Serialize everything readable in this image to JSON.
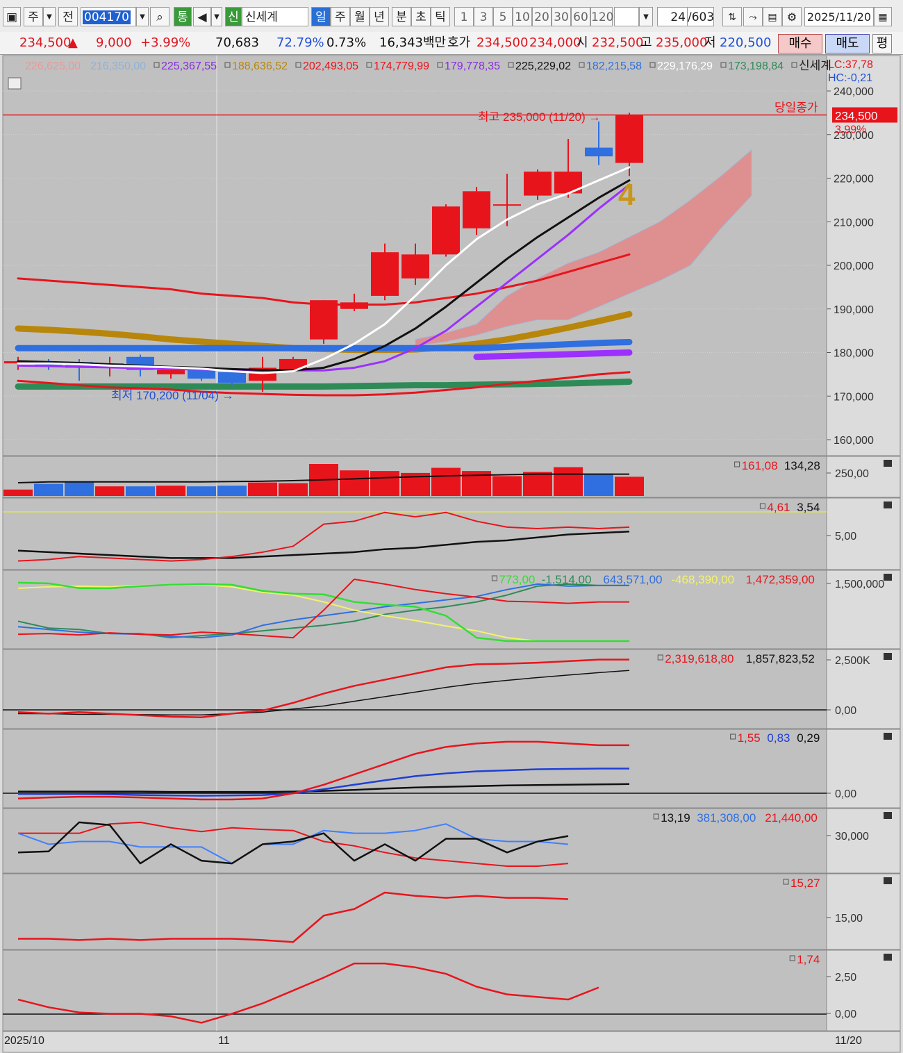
{
  "toolbar": {
    "freq": "주",
    "prev": "전",
    "code": "004170",
    "badge_tong": "통",
    "badge_sin": "신",
    "name": "신세계",
    "periods": [
      "일",
      "주",
      "월",
      "년",
      "분",
      "초",
      "틱"
    ],
    "active_period": "일",
    "intervals": [
      "1",
      "3",
      "5",
      "10",
      "20",
      "30",
      "60",
      "120"
    ],
    "count": "24",
    "total": "/603",
    "date": "2025/11/20"
  },
  "quote": {
    "price": "234,500",
    "arrow": "▲",
    "change": "9,000",
    "change_pct": "+3.99%",
    "volume": "70,683",
    "vol_ratio": "72.79%",
    "turnover": "0.73%",
    "amount": "16,343백만",
    "hoga_label": "호가",
    "ask": "234,500",
    "bid": "234,000",
    "open_label": "시",
    "open": "232,500",
    "high_label": "고",
    "high": "235,000",
    "low_label": "저",
    "low": "220,500",
    "buy": "매수",
    "sell": "매도",
    "eval": "평"
  },
  "colors": {
    "up": "#e8141c",
    "down": "#2f6fe0",
    "bg": "#c0c0c0",
    "axis_bg": "#dcdcdc"
  },
  "chart_data": {
    "type": "candlestick",
    "x_start_label": "2025/10",
    "x_mid_label": "11",
    "x_end_label": "11/20",
    "ylim": [
      155000,
      245000
    ],
    "price_ticks": [
      160000,
      170000,
      180000,
      190000,
      200000,
      210000,
      220000,
      230000,
      240000
    ],
    "price_tick_labels": [
      "160,000",
      "170,000",
      "180,000",
      "190,000",
      "200,000",
      "210,000",
      "220,000",
      "230,000",
      "240,000"
    ],
    "candles": [
      {
        "o": 177500,
        "h": 179000,
        "l": 176000,
        "c": 178000
      },
      {
        "o": 177500,
        "h": 178500,
        "l": 176000,
        "c": 177000
      },
      {
        "o": 177800,
        "h": 178500,
        "l": 173500,
        "c": 176500
      },
      {
        "o": 177000,
        "h": 179000,
        "l": 174500,
        "c": 177500
      },
      {
        "o": 179000,
        "h": 179500,
        "l": 174500,
        "c": 176000
      },
      {
        "o": 175000,
        "h": 176500,
        "l": 174000,
        "c": 176000
      },
      {
        "o": 176000,
        "h": 176500,
        "l": 173500,
        "c": 174000
      },
      {
        "o": 175500,
        "h": 176000,
        "l": 172500,
        "c": 173000
      },
      {
        "o": 173500,
        "h": 179000,
        "l": 171000,
        "c": 176500
      },
      {
        "o": 176000,
        "h": 179000,
        "l": 175500,
        "c": 178500
      },
      {
        "o": 183000,
        "h": 192000,
        "l": 182000,
        "c": 192000
      },
      {
        "o": 190000,
        "h": 193500,
        "l": 189500,
        "c": 191500
      },
      {
        "o": 193000,
        "h": 205000,
        "l": 192000,
        "c": 203000
      },
      {
        "o": 197000,
        "h": 205000,
        "l": 195500,
        "c": 202500
      },
      {
        "o": 202500,
        "h": 214000,
        "l": 202000,
        "c": 213500
      },
      {
        "o": 208500,
        "h": 218000,
        "l": 207000,
        "c": 217000
      },
      {
        "o": 214000,
        "h": 221000,
        "l": 209000,
        "c": 214000
      },
      {
        "o": 216000,
        "h": 222000,
        "l": 215000,
        "c": 221500
      },
      {
        "o": 216500,
        "h": 229000,
        "l": 215500,
        "c": 221500
      },
      {
        "o": 227000,
        "h": 233000,
        "l": 223000,
        "c": 225000
      },
      {
        "o": 223500,
        "h": 235000,
        "l": 220500,
        "c": 234500
      }
    ],
    "ma_legend": [
      {
        "value": "226,625,00",
        "color": "#e79a9a"
      },
      {
        "value": "216,350,00",
        "color": "#8fb1d8"
      },
      {
        "value": "225,367,55",
        "color": "#8a2be2"
      },
      {
        "value": "188,636,52",
        "color": "#b8860b"
      },
      {
        "value": "202,493,05",
        "color": "#e8141c"
      },
      {
        "value": "174,779,99",
        "color": "#e8141c"
      },
      {
        "value": "179,778,35",
        "color": "#8a2be2"
      },
      {
        "value": "225,229,02",
        "color": "#111111"
      },
      {
        "value": "182,215,58",
        "color": "#2f6fe0"
      },
      {
        "value": "229,176,29",
        "color": "#ffffff"
      },
      {
        "value": "173,198,84",
        "color": "#2e8b57"
      }
    ],
    "legend_name": "신세계",
    "lc": "LC:37,78",
    "hc": "HC:-0,21",
    "last_price_label": "234,500",
    "last_pct_label": "3,99%",
    "close_line_label": "당일종가",
    "high_annotation": "최고 235,000 (11/20)",
    "low_annotation": "최저 170,200 (11/04)",
    "count_marker": "4",
    "sma5": [
      177500,
      177500,
      177300,
      177000,
      176800,
      176600,
      176300,
      175700,
      175300,
      175700,
      178500,
      182000,
      186500,
      193000,
      200000,
      206000,
      210500,
      214000,
      216500,
      219500,
      222500
    ],
    "sma10": [
      178000,
      177800,
      177600,
      177300,
      177000,
      176700,
      176500,
      176200,
      176000,
      175900,
      176500,
      178500,
      181500,
      185500,
      190500,
      196000,
      201500,
      206500,
      211000,
      215500,
      219500
    ],
    "sma20": [
      177000,
      176900,
      176700,
      176600,
      176400,
      176200,
      176100,
      176000,
      176000,
      175900,
      175900,
      176500,
      178000,
      181000,
      185000,
      190500,
      196000,
      201500,
      207000,
      213000,
      218500
    ],
    "bb_upper": [
      197000,
      196500,
      196000,
      195500,
      195000,
      194500,
      193500,
      193000,
      192500,
      191500,
      191000,
      191000,
      191000,
      191500,
      192500,
      193500,
      195000,
      196500,
      198500,
      200500,
      202500
    ],
    "bb_lower": [
      173500,
      173000,
      172500,
      172000,
      171800,
      171500,
      171000,
      170700,
      170500,
      170300,
      170200,
      170200,
      170400,
      170800,
      171400,
      172000,
      172800,
      173500,
      174200,
      175000,
      175500
    ],
    "ma60": [
      185500,
      185200,
      184800,
      184300,
      183700,
      183000,
      182500,
      182000,
      181500,
      181000,
      180800,
      180600,
      180600,
      180700,
      181200,
      182000,
      183000,
      184300,
      185700,
      187200,
      188800
    ],
    "ma120": [
      181000,
      181000,
      181000,
      181000,
      181000,
      181000,
      181000,
      181000,
      181000,
      181000,
      181000,
      181000,
      181000,
      181000,
      181000,
      181000,
      181300,
      181600,
      181900,
      182200,
      182400
    ],
    "ma240": [
      172200,
      172200,
      172200,
      172200,
      172200,
      172200,
      172200,
      172200,
      172200,
      172200,
      172200,
      172300,
      172400,
      172500,
      172500,
      172600,
      172700,
      172800,
      172900,
      173100,
      173300
    ],
    "ma_purple_thick": [
      179000,
      179200,
      179400,
      179600,
      179800,
      180000
    ],
    "cloud_upper": [
      183000,
      184500,
      186500,
      193000,
      197000,
      200500,
      203000,
      206500,
      210000,
      215000,
      220500,
      226500
    ],
    "cloud_lower": [
      181500,
      182500,
      184000,
      186000,
      187500,
      187500,
      190500,
      193500,
      196500,
      200000,
      208500,
      216000
    ],
    "volume_legend": [
      "161,08",
      "134,28"
    ],
    "volume_axis_label": "250,00",
    "volume": [
      20,
      38,
      45,
      30,
      30,
      32,
      30,
      32,
      42,
      40,
      100,
      80,
      78,
      72,
      88,
      78,
      62,
      75,
      90,
      70,
      60
    ],
    "volume_ma": [
      35,
      38,
      38,
      38,
      38,
      38,
      38,
      39,
      40,
      42,
      45,
      48,
      52,
      55,
      58,
      60,
      62,
      64,
      64,
      64,
      64
    ],
    "ind1_legend": [
      "4,61",
      "3,54"
    ],
    "ind1_axis_label": "5,00",
    "ind1_red": [
      2.3,
      2.4,
      2.6,
      2.5,
      2.4,
      2.3,
      2.4,
      2.6,
      2.9,
      3.3,
      4.8,
      5.0,
      5.6,
      5.3,
      5.6,
      5.0,
      4.6,
      4.5,
      4.6,
      4.5,
      4.6
    ],
    "ind1_black": [
      3.0,
      2.9,
      2.8,
      2.7,
      2.6,
      2.5,
      2.5,
      2.5,
      2.6,
      2.7,
      2.8,
      2.9,
      3.1,
      3.2,
      3.4,
      3.6,
      3.7,
      3.9,
      4.1,
      4.2,
      4.3
    ],
    "ind2_legend": [
      "773,00",
      "-1,514,00",
      "643,571,00",
      "-468,390,00",
      "1,472,359,00"
    ],
    "ind2_axis_label": "1,500,000",
    "ind2_green": [
      0.9,
      0.89,
      0.82,
      0.82,
      0.85,
      0.87,
      0.88,
      0.87,
      0.78,
      0.74,
      0.73,
      0.62,
      0.58,
      0.55,
      0.42,
      0.1,
      0.05,
      0.05,
      0.05,
      0.05,
      0.05
    ],
    "ind2_yellow": [
      0.82,
      0.84,
      0.85,
      0.84,
      0.86,
      0.86,
      0.87,
      0.84,
      0.76,
      0.72,
      0.62,
      0.5,
      0.42,
      0.35,
      0.27,
      0.2,
      0.1,
      0.05,
      0.05,
      0.05,
      0.05
    ],
    "ind2_red": [
      0.15,
      0.16,
      0.14,
      0.17,
      0.15,
      0.14,
      0.18,
      0.16,
      0.13,
      0.1,
      0.5,
      0.95,
      0.88,
      0.8,
      0.74,
      0.69,
      0.63,
      0.62,
      0.6,
      0.62,
      0.62
    ],
    "ind2_blue": [
      0.26,
      0.22,
      0.18,
      0.16,
      0.15,
      0.12,
      0.1,
      0.14,
      0.28,
      0.36,
      0.42,
      0.48,
      0.55,
      0.6,
      0.65,
      0.7,
      0.8,
      0.88,
      0.85,
      0.86,
      0.86
    ],
    "ind2_teal": [
      0.34,
      0.24,
      0.22,
      0.16,
      0.16,
      0.1,
      0.13,
      0.16,
      0.2,
      0.24,
      0.28,
      0.34,
      0.44,
      0.5,
      0.55,
      0.62,
      0.72,
      0.85,
      0.88,
      0.86,
      0.86
    ],
    "ind3_legend": [
      "2,319,618,80",
      "1,857,823,52"
    ],
    "ind3_axis_labels": [
      "2,500K",
      "0,00"
    ],
    "ind3_red": [
      -0.05,
      -0.1,
      -0.05,
      -0.1,
      -0.15,
      -0.2,
      -0.22,
      -0.1,
      0.0,
      0.25,
      0.55,
      0.8,
      1.0,
      1.2,
      1.4,
      1.5,
      1.52,
      1.55,
      1.6,
      1.65,
      1.65
    ],
    "ind3_black": [
      -0.1,
      -0.1,
      -0.12,
      -0.12,
      -0.13,
      -0.14,
      -0.14,
      -0.1,
      -0.05,
      0.05,
      0.15,
      0.3,
      0.45,
      0.6,
      0.75,
      0.88,
      0.98,
      1.07,
      1.15,
      1.23,
      1.3
    ],
    "ind4_legend": [
      "1,55",
      "0,83",
      "0,29"
    ],
    "ind4_axis_label": "0,00",
    "ind4_red": [
      -0.15,
      -0.12,
      -0.1,
      -0.1,
      -0.12,
      -0.15,
      -0.18,
      -0.18,
      -0.15,
      0.0,
      0.25,
      0.55,
      0.85,
      1.15,
      1.35,
      1.45,
      1.5,
      1.5,
      1.45,
      1.4,
      1.4
    ],
    "ind4_blue": [
      -0.02,
      -0.02,
      -0.02,
      -0.03,
      -0.05,
      -0.06,
      -0.07,
      -0.06,
      -0.05,
      0.0,
      0.12,
      0.25,
      0.38,
      0.5,
      0.58,
      0.64,
      0.67,
      0.7,
      0.71,
      0.72,
      0.72
    ],
    "ind4_black": [
      0.05,
      0.05,
      0.05,
      0.05,
      0.05,
      0.04,
      0.04,
      0.04,
      0.04,
      0.05,
      0.07,
      0.1,
      0.14,
      0.17,
      0.19,
      0.21,
      0.23,
      0.24,
      0.25,
      0.26,
      0.27
    ],
    "ind5_legend": [
      "13,19",
      "381,308,00",
      "21,440,00"
    ],
    "ind5_axis_label": "30,000",
    "ind5_black": [
      0.3,
      0.32,
      0.85,
      0.8,
      0.1,
      0.45,
      0.15,
      0.1,
      0.45,
      0.5,
      0.65,
      0.15,
      0.45,
      0.15,
      0.55,
      0.55,
      0.3,
      0.5,
      0.6
    ],
    "ind5_blue": [
      0.65,
      0.45,
      0.5,
      0.5,
      0.4,
      0.4,
      0.4,
      0.1,
      0.45,
      0.45,
      0.7,
      0.65,
      0.65,
      0.7,
      0.82,
      0.55,
      0.5,
      0.5,
      0.45
    ],
    "ind5_red": [
      0.65,
      0.65,
      0.65,
      0.82,
      0.85,
      0.75,
      0.68,
      0.75,
      0.72,
      0.7,
      0.5,
      0.42,
      0.3,
      0.2,
      0.15,
      0.1,
      0.05,
      0.05,
      0.1
    ],
    "ind6_legend": [
      "15,27"
    ],
    "ind6_axis_label": "15,00",
    "ind6_red": [
      0.1,
      0.1,
      0.08,
      0.1,
      0.08,
      0.1,
      0.1,
      0.1,
      0.08,
      0.05,
      0.45,
      0.55,
      0.8,
      0.75,
      0.72,
      0.75,
      0.72,
      0.72,
      0.7
    ],
    "ind7_legend": [
      "1,74"
    ],
    "ind7_axis_labels": [
      "2,50",
      "0,00"
    ],
    "ind7_red": [
      0.8,
      0.2,
      -0.2,
      -0.3,
      -0.3,
      -0.5,
      -1.0,
      -0.3,
      0.5,
      1.5,
      2.5,
      3.6,
      3.6,
      3.3,
      2.8,
      1.8,
      1.2,
      1.0,
      0.8,
      1.74
    ]
  }
}
